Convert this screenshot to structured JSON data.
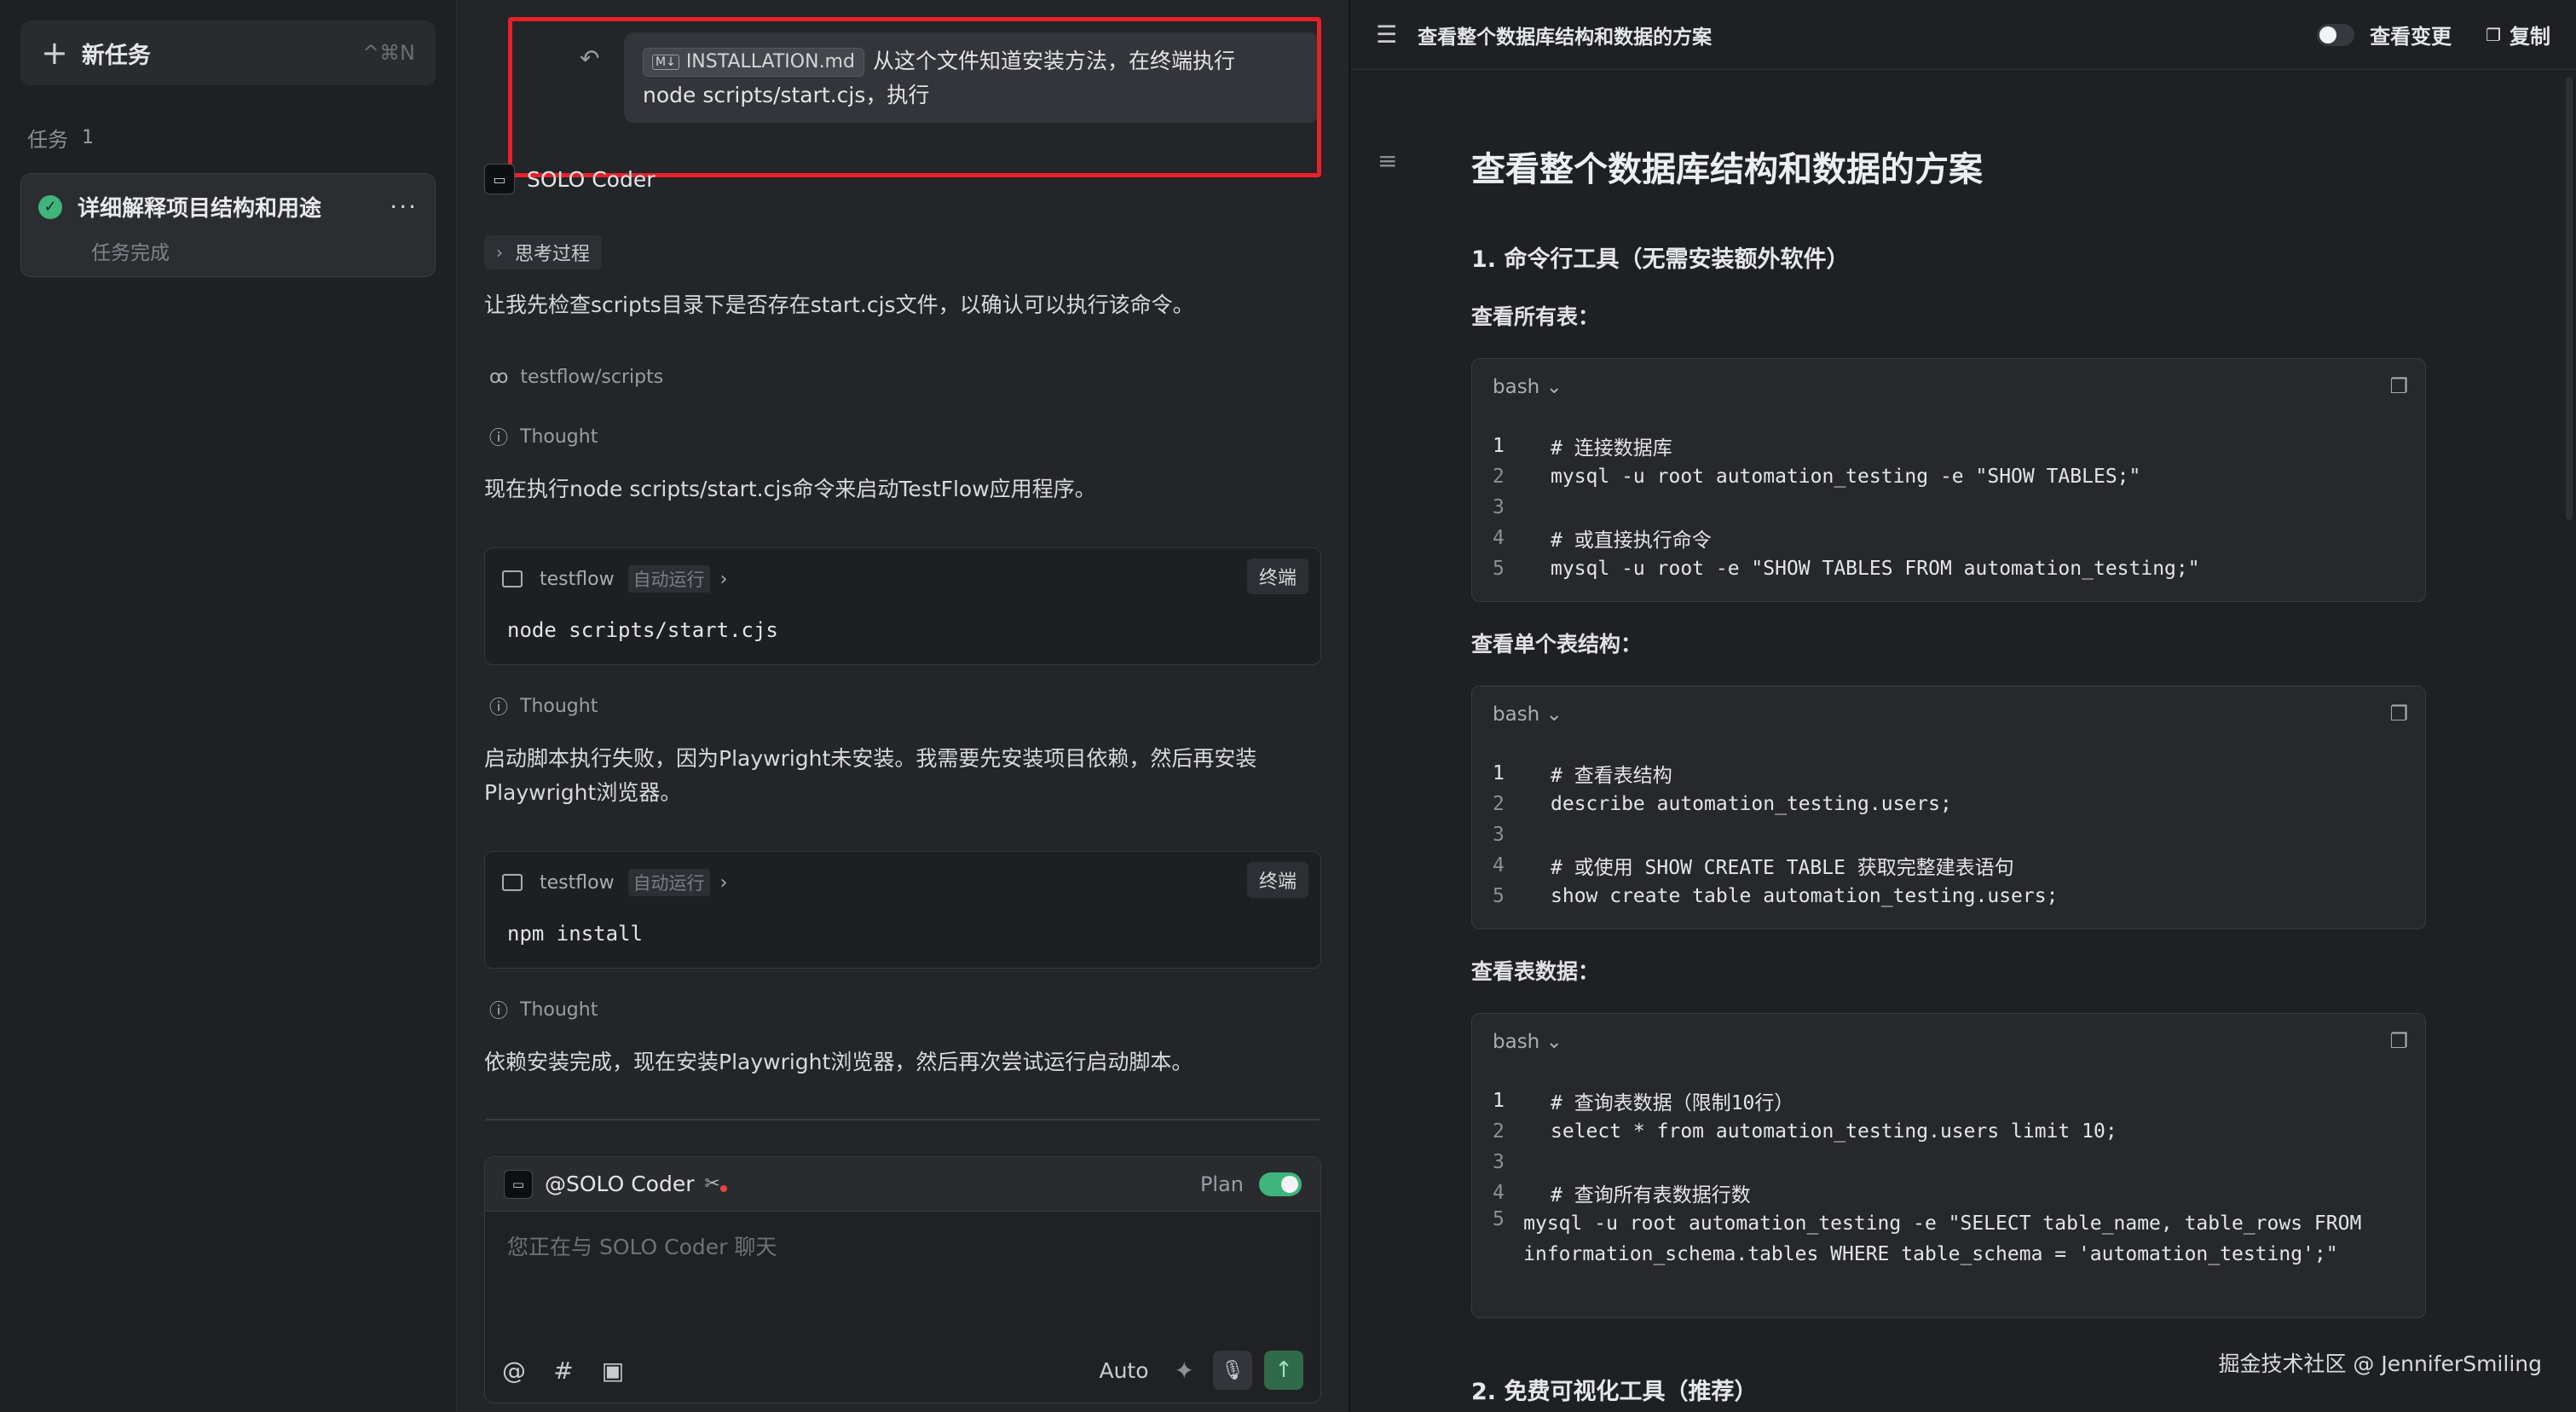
{
  "sidebar": {
    "new_task_label": "新任务",
    "new_task_shortcut": "^⌘N",
    "section_label": "任务",
    "section_count": "1",
    "task": {
      "title": "详细解释项目结构和用途",
      "status": "任务完成",
      "more": "···"
    }
  },
  "chat": {
    "user_message": {
      "file_chip": "INSTALLATION.md",
      "line1": "从这个文件知道安装方法，在终端执行",
      "line2": "node scripts/start.cjs，执行"
    },
    "agent_name": "SOLO Coder",
    "thinking_label": "思考过程",
    "para1": "让我先检查scripts目录下是否存在start.cjs文件，以确认可以执行该命令。",
    "browse_path": "testflow/scripts",
    "thought_label": "Thought",
    "para2": "现在执行node scripts/start.cjs命令来启动TestFlow应用程序。",
    "cmd1": {
      "project": "testflow",
      "badge": "自动运行",
      "terminal_btn": "终端",
      "command": "node scripts/start.cjs"
    },
    "para3_line1": "启动脚本执行失败，因为Playwright未安装。我需要先安装项目依赖，然后再安装",
    "para3_line2": "Playwright浏览器。",
    "cmd2": {
      "project": "testflow",
      "badge": "自动运行",
      "terminal_btn": "终端",
      "command": "npm install"
    },
    "para4": "依赖安装完成，现在安装Playwright浏览器，然后再次尝试运行启动脚本。",
    "input": {
      "mention": "@SOLO Coder",
      "plan_label": "Plan",
      "placeholder": "您正在与 SOLO Coder 聊天",
      "auto_label": "Auto"
    }
  },
  "doc": {
    "header_title": "查看整个数据库结构和数据的方案",
    "view_changes": "查看变更",
    "copy": "复制",
    "h1": "查看整个数据库结构和数据的方案",
    "section1": "1. 命令行工具（无需安装额外软件）",
    "sub1": "查看所有表：",
    "sub2": "查看单个表结构：",
    "sub3": "查看表数据：",
    "section2": "2. 免费可视化工具（推荐）",
    "code_lang": "bash",
    "code1": [
      {
        "n": "1",
        "t": "# 连接数据库"
      },
      {
        "n": "2",
        "t": "mysql -u root automation_testing -e \"SHOW TABLES;\""
      },
      {
        "n": "3",
        "t": ""
      },
      {
        "n": "4",
        "t": "# 或直接执行命令"
      },
      {
        "n": "5",
        "t": "mysql -u root -e \"SHOW TABLES FROM automation_testing;\""
      }
    ],
    "code2": [
      {
        "n": "1",
        "t": "# 查看表结构"
      },
      {
        "n": "2",
        "t": "describe automation_testing.users;"
      },
      {
        "n": "3",
        "t": ""
      },
      {
        "n": "4",
        "t": "# 或使用 SHOW CREATE TABLE 获取完整建表语句"
      },
      {
        "n": "5",
        "t": "show create table automation_testing.users;"
      }
    ],
    "code3": [
      {
        "n": "1",
        "t": "# 查询表数据（限制10行）"
      },
      {
        "n": "2",
        "t": "select * from automation_testing.users limit 10;"
      },
      {
        "n": "3",
        "t": ""
      },
      {
        "n": "4",
        "t": "# 查询所有表数据行数"
      },
      {
        "n": "5",
        "t": "mysql -u root automation_testing -e \"SELECT table_name, table_rows FROM information_schema.tables WHERE table_schema = 'automation_testing';\""
      }
    ]
  },
  "watermark": "掘金技术社区 @ JenniferSmiling"
}
